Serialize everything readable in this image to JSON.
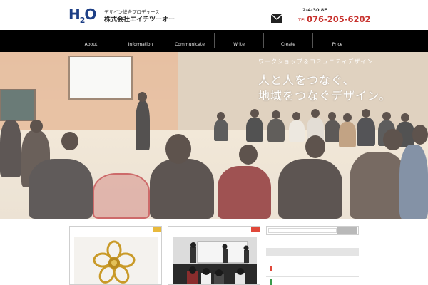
{
  "header": {
    "logo": "H2O",
    "tagline": "デザイン総合プロデュース",
    "company": "株式会社エイチツーオー",
    "address": "2-4-30 8F",
    "tel_label": "TEL",
    "tel": "076-205-6202"
  },
  "nav": {
    "items": [
      {
        "label": "About"
      },
      {
        "label": "Information"
      },
      {
        "label": "Communicate"
      },
      {
        "label": "Write"
      },
      {
        "label": "Create"
      },
      {
        "label": "Price"
      }
    ]
  },
  "hero": {
    "subtitle": "ワークショップ＆コミュニティデザイン",
    "title_line1": "人と人をつなぐ、",
    "title_line2": "地域をつなぐデザイン。"
  },
  "icons": {
    "mail": "mail-icon",
    "search": "search-button"
  },
  "colors": {
    "brand": "#1d3f86",
    "accent_red": "#c8322e",
    "nav_bg": "#000000",
    "card1_corner": "#e8b93c",
    "card2_corner": "#e0483a"
  }
}
